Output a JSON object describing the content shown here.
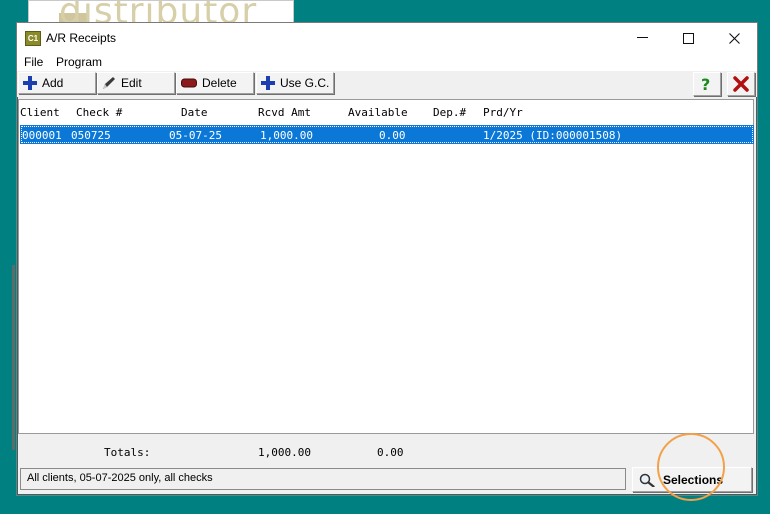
{
  "background_app": {
    "text": "distributor"
  },
  "window": {
    "title": "A/R Receipts",
    "app_icon_text": "C1"
  },
  "menu": [
    "File",
    "Program"
  ],
  "toolbar": {
    "add_label": "Add",
    "edit_label": "Edit",
    "delete_label": "Delete",
    "use_gc_label": "Use G.C.",
    "help_icon": "question-icon",
    "close_icon": "red-x-icon"
  },
  "grid": {
    "columns": [
      "Client",
      "Check #",
      "Date",
      "Rcvd Amt",
      "Available",
      "Dep.#",
      "Prd/Yr"
    ],
    "rows": [
      {
        "client": "000001",
        "check": "050725",
        "date": "05-07-25",
        "rcvd": "1,000.00",
        "available": "0.00",
        "dep": "",
        "prd": "1/2025 (ID:000001508)"
      }
    ]
  },
  "totals": {
    "label": "Totals:",
    "rcvd": "1,000.00",
    "available": "0.00"
  },
  "status_text": "All clients, 05-07-2025 only, all checks",
  "selections_label": "Selections",
  "colors": {
    "selection": "#0b78d7",
    "desktop": "#008080",
    "highlight": "#f2a14a"
  }
}
